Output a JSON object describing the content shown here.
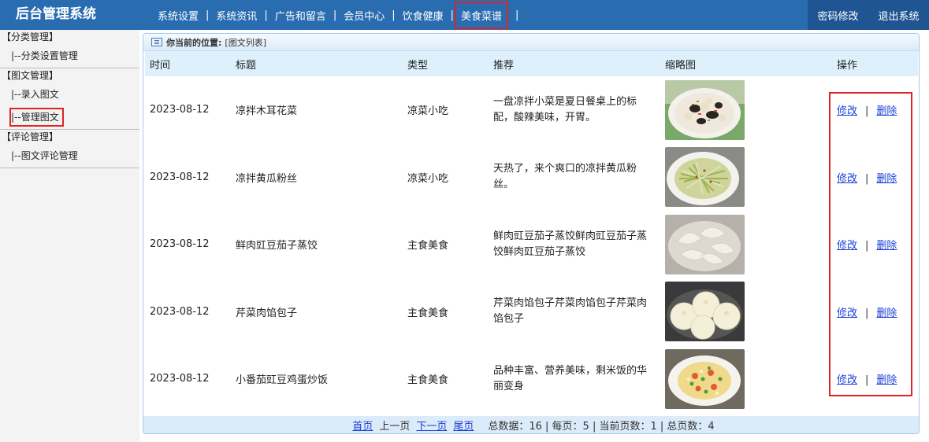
{
  "header": {
    "brand": "后台管理系统",
    "nav": [
      "系统设置",
      "系统资讯",
      "广告和留言",
      "会员中心",
      "饮食健康",
      "美食菜谱"
    ],
    "nav_active_index": 5,
    "right_links": [
      "密码修改",
      "退出系统"
    ]
  },
  "sidebar": {
    "groups": [
      {
        "title": "【分类管理】",
        "items": [
          {
            "label": "|--分类设置管理",
            "active": false
          }
        ]
      },
      {
        "title": "【图文管理】",
        "items": [
          {
            "label": "|--录入图文",
            "active": false
          },
          {
            "label": "|--管理图文",
            "active": true
          }
        ]
      },
      {
        "title": "【评论管理】",
        "items": [
          {
            "label": "|--图文评论管理",
            "active": false
          }
        ]
      }
    ]
  },
  "breadcrumb": {
    "label": "你当前的位置:",
    "value": "[图文列表]"
  },
  "table": {
    "columns": [
      "时间",
      "标题",
      "类型",
      "推荐",
      "缩略图",
      "操作"
    ],
    "rows": [
      {
        "time": "2023-08-12",
        "title": "凉拌木耳花菜",
        "type": "凉菜小吃",
        "recommend": "一盘凉拌小菜是夏日餐桌上的标配，酸辣美味，开胃。",
        "thumb": "dish-1"
      },
      {
        "time": "2023-08-12",
        "title": "凉拌黄瓜粉丝",
        "type": "凉菜小吃",
        "recommend": "天热了，来个爽口的凉拌黄瓜粉丝。",
        "thumb": "dish-2"
      },
      {
        "time": "2023-08-12",
        "title": "鲜肉豇豆茄子蒸饺",
        "type": "主食美食",
        "recommend": "鲜肉豇豆茄子蒸饺鲜肉豇豆茄子蒸饺鲜肉豇豆茄子蒸饺",
        "thumb": "dish-3"
      },
      {
        "time": "2023-08-12",
        "title": "芹菜肉馅包子",
        "type": "主食美食",
        "recommend": "芹菜肉馅包子芹菜肉馅包子芹菜肉馅包子",
        "thumb": "dish-4"
      },
      {
        "time": "2023-08-12",
        "title": "小番茄豇豆鸡蛋炒饭",
        "type": "主食美食",
        "recommend": "品种丰富、营养美味，剩米饭的华丽变身",
        "thumb": "dish-5"
      }
    ],
    "edit_label": "修改",
    "delete_label": "删除",
    "op_separator": "|"
  },
  "pager": {
    "first": "首页",
    "prev": "上一页",
    "next": "下一页",
    "last": "尾页",
    "stats": "总数据：16 | 每页：5 | 当前页数：1 | 总页数：4"
  },
  "colors": {
    "header_bg": "#2a6cb0",
    "header_right_bg": "#1e5592",
    "table_head_bg": "#def0fb",
    "highlight": "#e02424",
    "link": "#1a3fd6"
  }
}
